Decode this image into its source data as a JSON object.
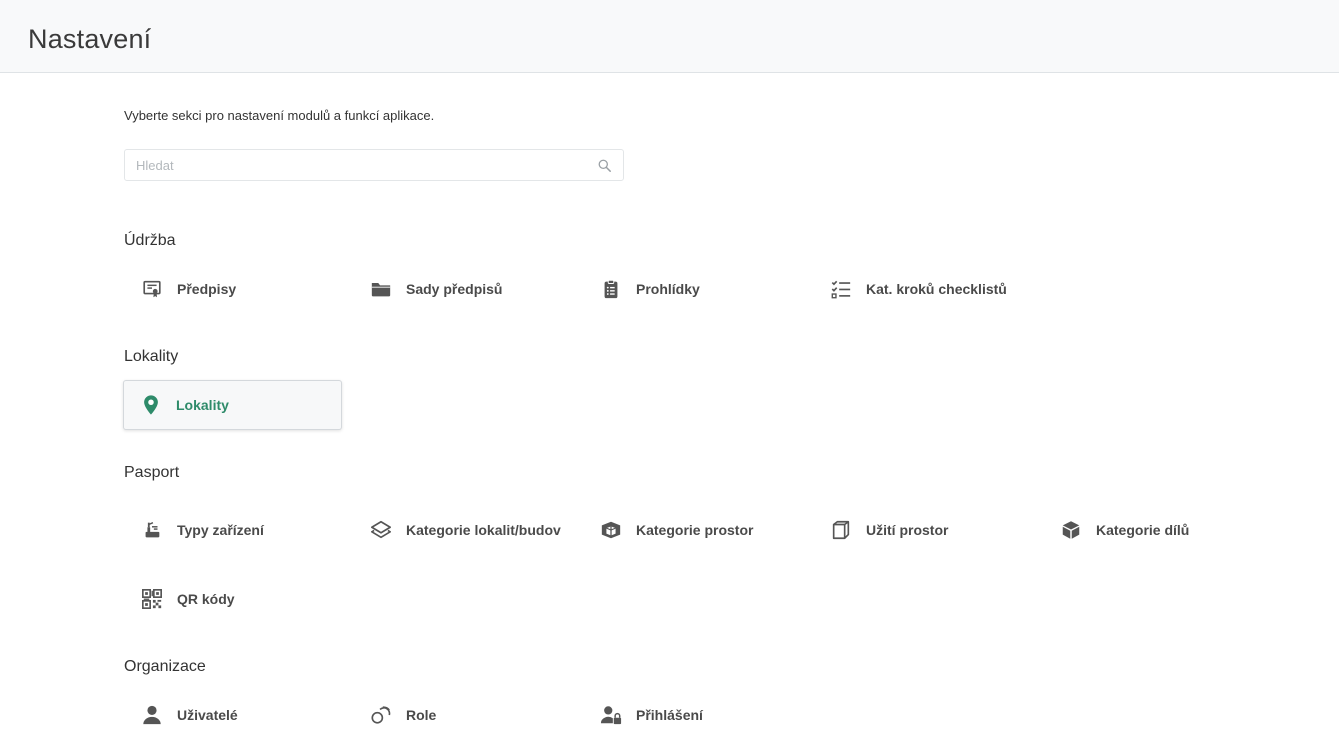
{
  "header": {
    "title": "Nastavení"
  },
  "intro": "Vyberte sekci pro nastavení modulů a funkcí aplikace.",
  "search": {
    "placeholder": "Hledat",
    "value": ""
  },
  "colors": {
    "accent": "#2e8b6a",
    "icon": "#555555",
    "text": "#4a4a4a"
  },
  "sections": [
    {
      "title": "Údržba",
      "items": [
        {
          "label": "Předpisy",
          "icon": "certificate-icon"
        },
        {
          "label": "Sady předpisů",
          "icon": "folder-icon"
        },
        {
          "label": "Prohlídky",
          "icon": "clipboard-list-icon"
        },
        {
          "label": "Kat. kroků checklistů",
          "icon": "checklist-icon"
        }
      ]
    },
    {
      "title": "Lokality",
      "items": [
        {
          "label": "Lokality",
          "icon": "map-marker-icon",
          "active": true
        }
      ]
    },
    {
      "title": "Pasport",
      "items": [
        {
          "label": "Typy zařízení",
          "icon": "device-type-icon"
        },
        {
          "label": "Kategorie lokalit/budov",
          "icon": "layers-icon"
        },
        {
          "label": "Kategorie prostor",
          "icon": "space-category-icon"
        },
        {
          "label": "Užití prostor",
          "icon": "space-usage-icon"
        },
        {
          "label": "Kategorie dílů",
          "icon": "cube-icon"
        },
        {
          "label": "QR kódy",
          "icon": "qr-code-icon"
        }
      ]
    },
    {
      "title": "Organizace",
      "items": [
        {
          "label": "Uživatelé",
          "icon": "user-icon"
        },
        {
          "label": "Role",
          "icon": "role-icon"
        },
        {
          "label": "Přihlášení",
          "icon": "user-lock-icon"
        }
      ]
    }
  ]
}
